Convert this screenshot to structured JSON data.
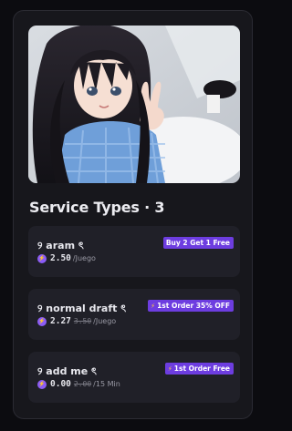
{
  "section": {
    "title": "Service Types · 3"
  },
  "services": [
    {
      "name": "୨ aram ৎ",
      "tag": "Buy 2 Get 1 Free",
      "tag_icon": "",
      "price": "2.50",
      "old_price": "",
      "unit": "/Juego"
    },
    {
      "name": "୨ normal draft ৎ",
      "tag": "1st Order 35% OFF",
      "tag_icon": "lightning-icon",
      "price": "2.27",
      "old_price": "3.50",
      "unit": "/Juego"
    },
    {
      "name": "୨ add me ৎ",
      "tag": "1st Order Free",
      "tag_icon": "lightning-icon",
      "price": "0.00",
      "old_price": "2.00",
      "unit": "/15 Min"
    }
  ],
  "colors": {
    "tag_bg": "#6d3de0",
    "coin": "#8b5cf6",
    "card_bg": "#17171c",
    "item_bg": "#202028"
  }
}
